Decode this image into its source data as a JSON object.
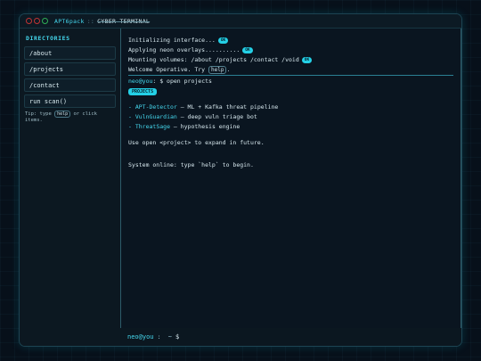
{
  "window": {
    "app_name": "APT6pack",
    "separator": "::",
    "title": "CYBER-TERMINAL"
  },
  "sidebar": {
    "heading": "DIRECTORIES",
    "items": [
      {
        "label": "/about"
      },
      {
        "label": "/projects"
      },
      {
        "label": "/contact"
      },
      {
        "label": "run scan()"
      }
    ],
    "tip_prefix": "Tip: type",
    "tip_key": "help",
    "tip_suffix": "or click items."
  },
  "terminal": {
    "lines": [
      {
        "text": "Initializing interface...",
        "badge": "OK"
      },
      {
        "text": "Applying neon overlays..........",
        "badge": "OK"
      },
      {
        "text": "Mounting volumes: /about /projects /contact /void",
        "badge": "OK"
      }
    ],
    "welcome_prefix": "Welcome Operative. Try",
    "welcome_key": "help",
    "welcome_suffix": ".",
    "prompt_user": "neo@you",
    "command": ": $ open projects",
    "chip": "PROJECTS",
    "projects": [
      {
        "bullet": "-",
        "name": "APT-Detector",
        "desc": "— ML + Kafka threat pipeline"
      },
      {
        "bullet": "-",
        "name": "VulnGuardian",
        "desc": "— deep vuln triage bot"
      },
      {
        "bullet": "-",
        "name": "ThreatSage",
        "desc": "— hypothesis engine"
      }
    ],
    "hint": "Use open <project> to expand in future.",
    "status": "System online: type `help` to begin."
  },
  "input": {
    "user": "neo@you",
    "colon": ":",
    "path": "~",
    "dollar": "$"
  },
  "colors": {
    "accent": "#24d0e6",
    "background": "#07101a",
    "close_dot": "#c13434",
    "max_dot": "#2fae56"
  }
}
